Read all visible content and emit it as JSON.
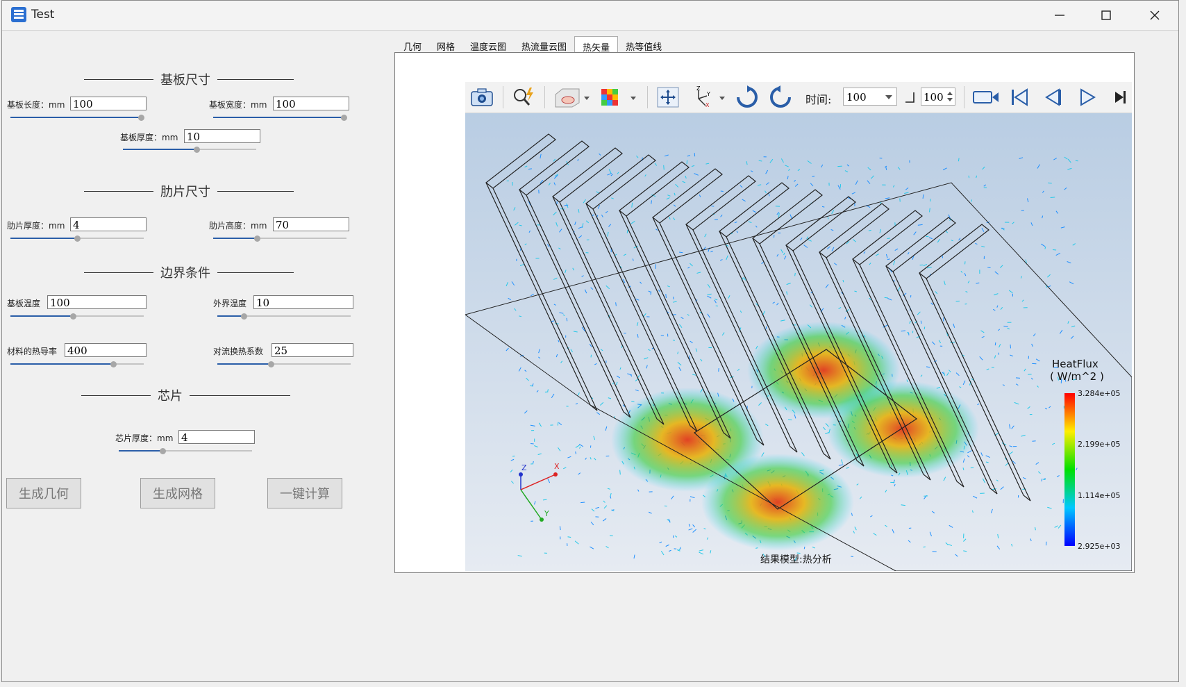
{
  "window": {
    "title": "Test",
    "controls": [
      "minimize-icon",
      "maximize-icon",
      "close-icon"
    ]
  },
  "sections": {
    "substrate": "基板尺寸",
    "fin": "肋片尺寸",
    "boundary": "边界条件",
    "chip": "芯片"
  },
  "fields": {
    "substrate_length": {
      "label": "基板长度：mm",
      "value": "100",
      "slider": 0.98
    },
    "substrate_width": {
      "label": "基板宽度：mm",
      "value": "100",
      "slider": 0.98
    },
    "substrate_thickness": {
      "label": "基板厚度：mm",
      "value": "10",
      "slider": 0.55
    },
    "fin_thickness": {
      "label": "肋片厚度：mm",
      "value": "4",
      "slider": 0.5
    },
    "fin_height": {
      "label": "肋片高度：mm",
      "value": "70",
      "slider": 0.33
    },
    "substrate_temp": {
      "label": "基板温度",
      "value": "100",
      "slider": 0.47
    },
    "ambient_temp": {
      "label": "外界温度",
      "value": "10",
      "slider": 0.2
    },
    "conductivity": {
      "label": "材料的热导率",
      "value": "400",
      "slider": 0.77
    },
    "convection": {
      "label": "对流换热系数",
      "value": "25",
      "slider": 0.4
    },
    "chip_thickness": {
      "label": "芯片厚度：mm",
      "value": "4",
      "slider": 0.33
    }
  },
  "buttons": {
    "geometry": "生成几何",
    "mesh": "生成网格",
    "compute": "一键计算"
  },
  "tabs": [
    "几何",
    "网格",
    "温度云图",
    "热流量云图",
    "热矢量",
    "热等值线"
  ],
  "active_tab": 4,
  "toolbar": {
    "time_label": "时间:",
    "time_value": "100",
    "spin_value": "100",
    "icons": [
      "camera-icon",
      "zoom-icon",
      "surface-icon",
      "colormap-icon",
      "fit-view-icon",
      "axes-icon",
      "rotate-cw-icon",
      "rotate-ccw-icon",
      "record-icon",
      "first-frame-icon",
      "prev-frame-icon",
      "play-icon",
      "last-frame-icon"
    ]
  },
  "legend": {
    "title": "HeatFlux",
    "unit": "( W/m^2 )",
    "ticks": [
      "3.284e+05",
      "2.199e+05",
      "1.114e+05",
      "2.925e+03"
    ]
  },
  "caption": "结果模型:热分析",
  "axes": {
    "x": "X",
    "y": "Y",
    "z": "Z"
  },
  "colors": {
    "accent": "#2a5ea8",
    "background_top": "#b9cde3",
    "background_bottom": "#e6ebf2"
  }
}
